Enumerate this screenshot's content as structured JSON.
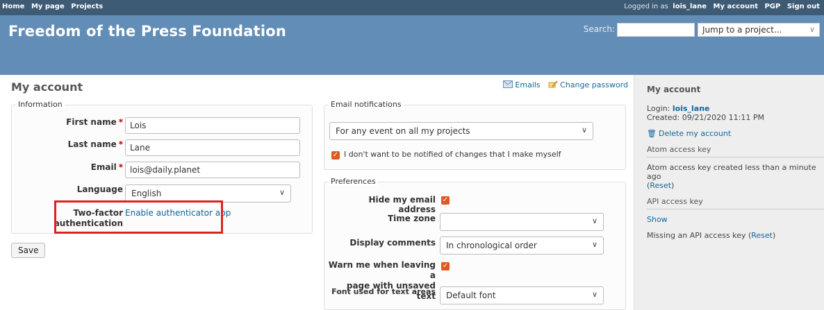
{
  "topmenu": {
    "left": [
      "Home",
      "My page",
      "Projects"
    ],
    "logged_prefix": "Logged in as",
    "user": "lois_lane",
    "right": [
      "My account",
      "PGP",
      "Sign out"
    ]
  },
  "header": {
    "title": "Freedom of the Press Foundation",
    "search_label": "Search:",
    "search_value": "",
    "jump_value": "Jump to a project..."
  },
  "content": {
    "title": "My account",
    "links": {
      "emails": "Emails",
      "change_password": "Change password"
    },
    "information": {
      "legend": "Information",
      "first_name_label": "First name",
      "first_name_value": "Lois",
      "last_name_label": "Last name",
      "last_name_value": "Lane",
      "email_label": "Email",
      "email_value": "lois@daily.planet",
      "required_mark": "*",
      "language_label": "Language",
      "language_value": "English",
      "twofactor_label_1": "Two-factor",
      "twofactor_label_2": "authentication",
      "twofactor_link": "Enable authenticator app"
    },
    "save_label": "Save",
    "notifications": {
      "legend": "Email notifications",
      "value": "For any event on all my projects",
      "no_self_label": "I don't want to be notified of changes that I make myself"
    },
    "preferences": {
      "legend": "Preferences",
      "hide_email_label": "Hide my email address",
      "time_zone_label": "Time zone",
      "time_zone_value": "",
      "display_comments_label": "Display comments",
      "display_comments_value": "In chronological order",
      "warn_label_1": "Warn me when leaving a",
      "warn_label_2": "page with unsaved text",
      "font_label": "Font used for text areas",
      "font_value": "Default font"
    }
  },
  "sidebar": {
    "title": "My account",
    "login_label": "Login:",
    "login_value": "lois_lane",
    "created": "Created: 09/21/2020 11:11 PM",
    "delete": "Delete my account",
    "atom_title": "Atom access key",
    "atom_text": "Atom access key created less than a minute ago",
    "reset": "Reset",
    "api_title": "API access key",
    "show": "Show",
    "api_text": "Missing an API access key"
  },
  "colors": {
    "top_bar": "#3e5b76",
    "header": "#628db6",
    "link": "#169",
    "checkbox": "#dd5a20",
    "highlight": "#e02020"
  }
}
